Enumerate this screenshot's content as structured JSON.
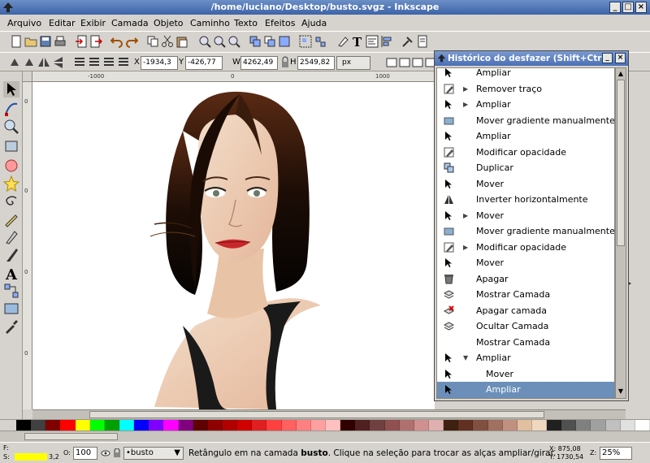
{
  "window": {
    "title": "/home/luciano/Desktop/busto.svgz - Inkscape",
    "minimize": "_",
    "maximize": "□",
    "close": "×"
  },
  "menu": [
    "Arquivo",
    "Editar",
    "Exibir",
    "Camada",
    "Objeto",
    "Caminho",
    "Texto",
    "Efeitos",
    "Ajuda"
  ],
  "controls": {
    "x_label": "X",
    "x_value": "-1934,3",
    "y_label": "Y",
    "y_value": "-426,77",
    "w_label": "W",
    "w_value": "4262,49",
    "h_label": "H",
    "h_value": "2549,82",
    "unit": "px"
  },
  "rulers": {
    "h_ticks": [
      "-1000",
      "0",
      "1000"
    ],
    "v_ticks": [
      "0",
      "0",
      "0",
      "0"
    ]
  },
  "dialog": {
    "title": "Histórico do desfazer (Shift+Ctrl+",
    "items": [
      {
        "label": "Ampliar",
        "icon": "zoom-arrow-icon",
        "expander": "",
        "indent": 0
      },
      {
        "label": "Remover traço",
        "icon": "pen-icon",
        "expander": "▶",
        "indent": 0
      },
      {
        "label": "Ampliar",
        "icon": "zoom-arrow-icon",
        "expander": "▶",
        "indent": 0
      },
      {
        "label": "Mover gradiente manualmente",
        "icon": "gradient-icon",
        "expander": "",
        "indent": 0
      },
      {
        "label": "Ampliar",
        "icon": "zoom-arrow-icon",
        "expander": "",
        "indent": 0
      },
      {
        "label": "Modificar opacidade",
        "icon": "pen-icon",
        "expander": "",
        "indent": 0
      },
      {
        "label": "Duplicar",
        "icon": "duplicate-icon",
        "expander": "",
        "indent": 0
      },
      {
        "label": "Mover",
        "icon": "arrow-icon",
        "expander": "",
        "indent": 0
      },
      {
        "label": "Inverter horizontalmente",
        "icon": "flip-icon",
        "expander": "",
        "indent": 0
      },
      {
        "label": "Mover",
        "icon": "arrow-icon",
        "expander": "▶",
        "indent": 0
      },
      {
        "label": "Mover gradiente manualmente",
        "icon": "gradient-icon",
        "expander": "",
        "indent": 0
      },
      {
        "label": "Modificar opacidade",
        "icon": "pen-icon",
        "expander": "▶",
        "indent": 0
      },
      {
        "label": "Mover",
        "icon": "arrow-icon",
        "expander": "",
        "indent": 0
      },
      {
        "label": "Apagar",
        "icon": "trash-icon",
        "expander": "",
        "indent": 0
      },
      {
        "label": "Mostrar Camada",
        "icon": "layer-icon",
        "expander": "",
        "indent": 0
      },
      {
        "label": "Apagar camada",
        "icon": "delete-layer-icon",
        "expander": "",
        "indent": 0
      },
      {
        "label": "Ocultar Camada",
        "icon": "layer-icon",
        "expander": "",
        "indent": 0
      },
      {
        "label": "Mostrar Camada",
        "icon": "",
        "expander": "",
        "indent": 0
      },
      {
        "label": "Ampliar",
        "icon": "arrow-icon",
        "expander": "▼",
        "indent": 0
      },
      {
        "label": "Mover",
        "icon": "arrow-icon",
        "expander": "",
        "indent": 1
      },
      {
        "label": "Ampliar",
        "icon": "arrow-icon",
        "expander": "",
        "indent": 1,
        "selected": true
      }
    ]
  },
  "status": {
    "fill_label": "F:",
    "stroke_label": "S:",
    "stroke_width": "3,2",
    "opacity_label": "O:",
    "opacity_value": "100",
    "layer": "•busto",
    "message_pre": "Retângulo em na camada ",
    "message_layer": "busto",
    "message_post": ". Clique na seleção para trocar as alças ampliar/girar.",
    "x_coord": "X: 875,08",
    "y_coord": "Y: 1730,54",
    "zoom_label": "Z:",
    "zoom_value": "25%",
    "fill_color": "#ffff00"
  },
  "palette": [
    "#000000",
    "#404040",
    "#800000",
    "#ff0000",
    "#ffff00",
    "#00ff00",
    "#00a000",
    "#00ffff",
    "#0000ff",
    "#8000ff",
    "#ff00ff",
    "#800080",
    "#600000",
    "#900000",
    "#b00000",
    "#d00000",
    "#e02020",
    "#ff4040",
    "#ff6060",
    "#ff8080",
    "#ffa0a0",
    "#ffc0c0",
    "#300000",
    "#502020",
    "#704040",
    "#905050",
    "#b07070",
    "#d09090",
    "#e0b0b0",
    "#402010",
    "#603020",
    "#805040",
    "#a07060",
    "#c09080",
    "#e0c0a0",
    "#f0d8c0",
    "#202020",
    "#505050",
    "#808080",
    "#a0a0a0",
    "#c0c0c0",
    "#e0e0e0",
    "#ffffff"
  ]
}
